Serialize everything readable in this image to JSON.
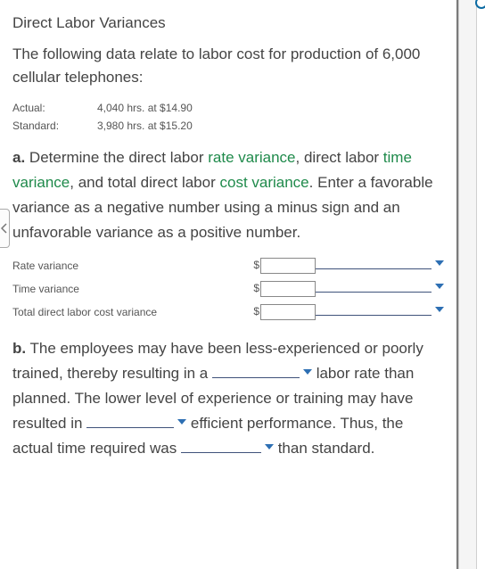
{
  "title": "Direct Labor Variances",
  "intro": "The following data relate to labor cost for production of 6,000 cellular telephones:",
  "data_rows": [
    {
      "label": "Actual:",
      "value": "4,040 hrs. at $14.90"
    },
    {
      "label": "Standard:",
      "value": "3,980 hrs. at $15.20"
    }
  ],
  "partA": {
    "letter": "a.",
    "seg1": "  Determine the direct labor ",
    "link1": "rate variance",
    "seg2": ", direct labor ",
    "link2": "time variance",
    "seg3": ", and total direct labor ",
    "link3": "cost variance",
    "seg4": ". Enter a favorable variance as a negative number using a minus sign and an unfavorable variance as a positive number."
  },
  "answers": [
    {
      "label": "Rate variance"
    },
    {
      "label": "Time variance"
    },
    {
      "label": "Total direct labor cost variance"
    }
  ],
  "dollar": "$",
  "partB": {
    "letter": "b.",
    "seg1": "  The employees may have been less-experienced or poorly trained, thereby resulting in a ",
    "seg2": " labor rate than planned. The lower level of experience or training may have resulted in ",
    "seg3": " efficient performance. Thus, the actual time required was ",
    "seg4": " than standard."
  }
}
